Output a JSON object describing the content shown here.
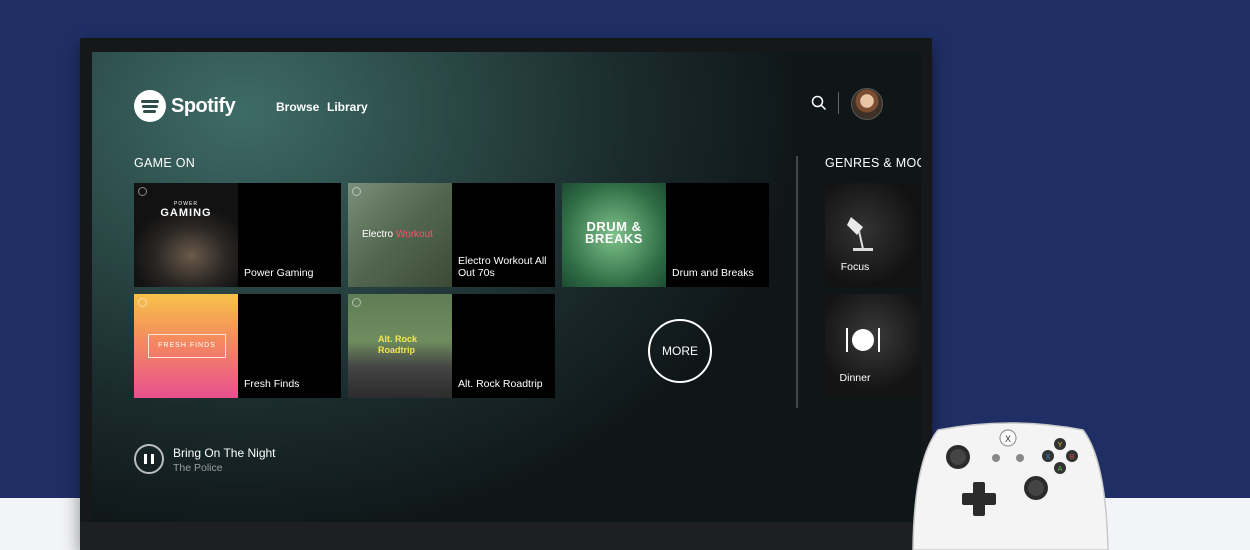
{
  "header": {
    "logo_text": "Spotify",
    "nav": [
      "Browse",
      "Library"
    ]
  },
  "section_game_on": {
    "title": "GAME ON",
    "tiles": [
      {
        "label": "Power Gaming",
        "art_small": "POWER",
        "art_big": "GAMING"
      },
      {
        "label": "Electro Workout All Out 70s",
        "art_word_1": "Electro ",
        "art_word_2": "Workout"
      },
      {
        "label": "Drum and Breaks",
        "art_big_1": "DRUM &",
        "art_big_2": "BREAKS"
      },
      {
        "label": "Fresh Finds",
        "art_box": "FRESH FINDS"
      },
      {
        "label": "Alt. Rock Roadtrip",
        "art_word_1": "Alt. Rock",
        "art_word_2": "Roadtrip"
      }
    ],
    "more_label": "MORE"
  },
  "section_genres": {
    "title": "GENRES & MOC",
    "tiles": [
      {
        "label": "Focus",
        "icon": "lamp-icon"
      },
      {
        "label": "Dinner",
        "icon": "plate-icon"
      }
    ]
  },
  "player": {
    "title": "Bring On The Night",
    "artist": "The Police",
    "state_icon": "pause-icon"
  },
  "colors": {
    "background": "#1f2f66",
    "screen_accent": "#3e6b66"
  }
}
